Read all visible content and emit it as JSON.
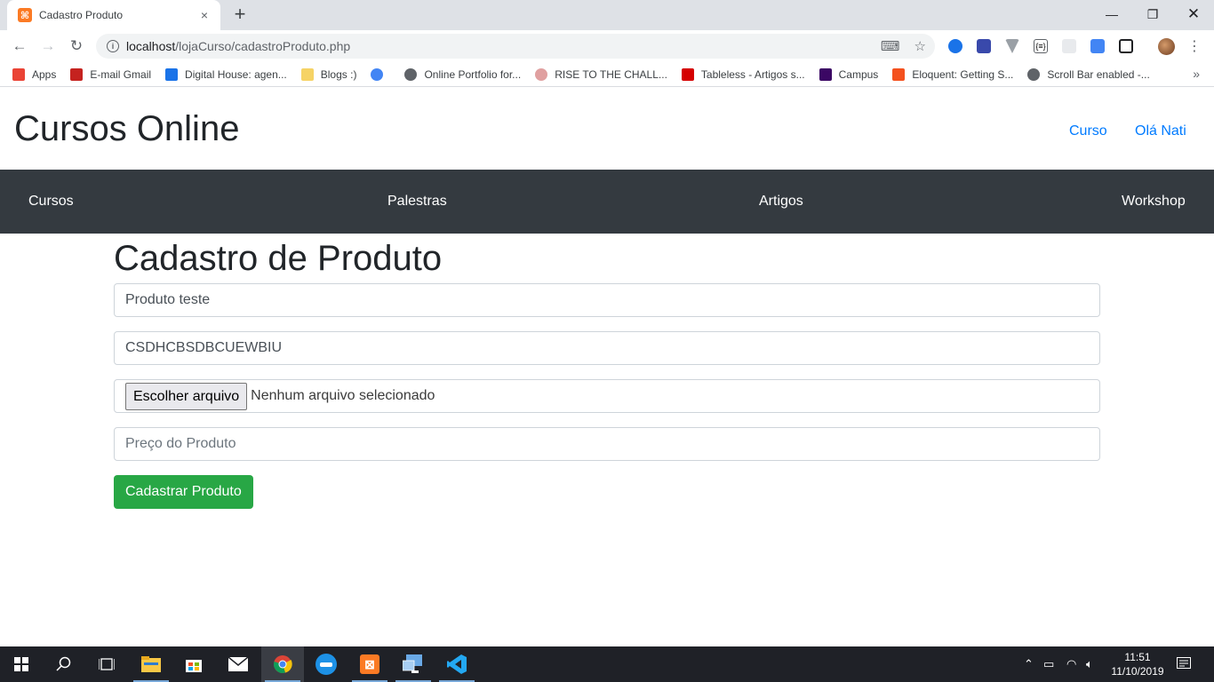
{
  "browser": {
    "tab_title": "Cadastro Produto",
    "tab_close": "×",
    "new_tab": "+",
    "url_host": "localhost",
    "url_path": "/lojaCurso/cadastroProduto.php",
    "bookmarks": [
      {
        "label": "Apps",
        "color": "#ea4335"
      },
      {
        "label": "E-mail Gmail",
        "color": "#c5221f"
      },
      {
        "label": "Digital House: agen...",
        "color": "#1a73e8"
      },
      {
        "label": "Blogs :)",
        "color": "#f6d365"
      },
      {
        "label": "",
        "color": "#4285f4"
      },
      {
        "label": "Online Portfolio for...",
        "color": "#5f6368"
      },
      {
        "label": "RISE TO THE CHALL...",
        "color": "#e0a0a0"
      },
      {
        "label": "Tableless - Artigos s...",
        "color": "#d50000"
      },
      {
        "label": "Campus",
        "color": "#3b0764"
      },
      {
        "label": "Eloquent: Getting S...",
        "color": "#f4511e"
      },
      {
        "label": "Scroll Bar enabled -...",
        "color": "#5f6368"
      }
    ],
    "bookmarks_more": "»"
  },
  "site": {
    "title": "Cursos Online",
    "links": [
      "Curso",
      "Olá Nati"
    ],
    "nav": [
      "Cursos",
      "Palestras",
      "Artigos",
      "Workshop"
    ]
  },
  "form": {
    "title": "Cadastro de Produto",
    "name_value": "Produto teste",
    "code_value": "CSDHCBSDBCUEWBIU",
    "file_button": "Escolher arquivo",
    "file_status": "Nenhum arquivo selecionado",
    "price_placeholder": "Preço do Produto",
    "submit_label": "Cadastrar Produto"
  },
  "taskbar": {
    "time": "11:51",
    "date": "11/10/2019"
  },
  "colors": {
    "nav_bg": "#343a40",
    "link": "#007bff",
    "submit": "#28a745"
  }
}
